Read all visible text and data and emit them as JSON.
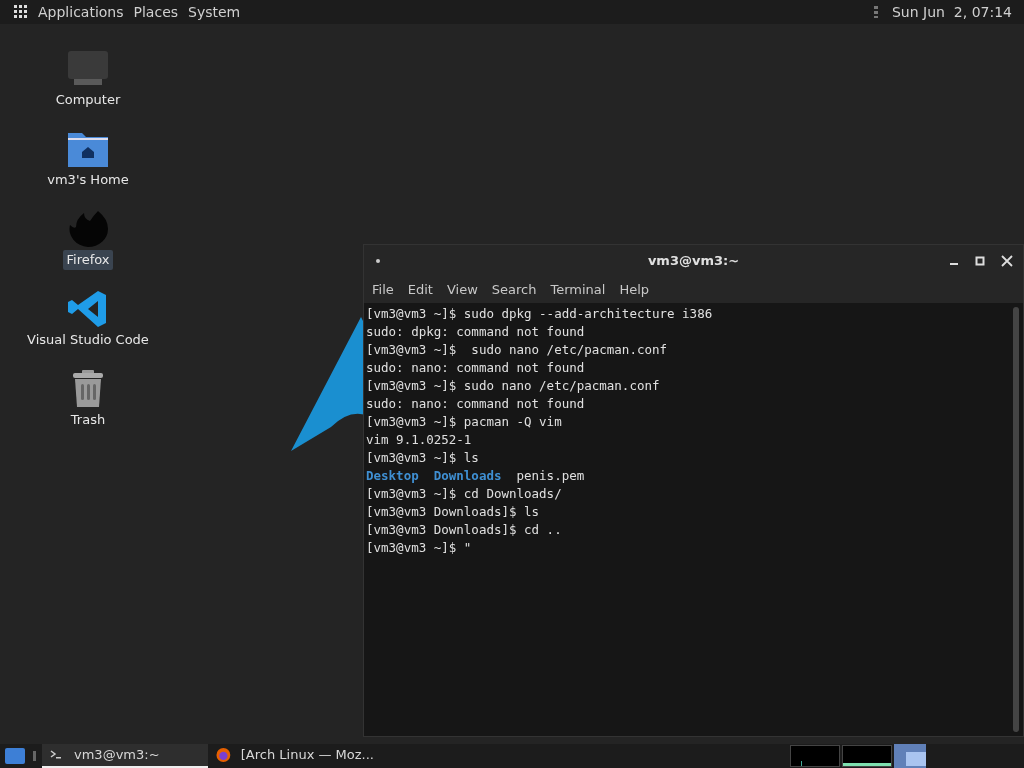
{
  "top_panel": {
    "menus": [
      "Applications",
      "Places",
      "System"
    ],
    "clock": "Sun Jun  2, 07:14"
  },
  "desktop_icons": [
    {
      "label": "Computer",
      "kind": "computer",
      "selected": false
    },
    {
      "label": "vm3's Home",
      "kind": "home",
      "selected": false
    },
    {
      "label": "Firefox",
      "kind": "firefox",
      "selected": true
    },
    {
      "label": "Visual Studio Code",
      "kind": "vscode",
      "selected": false
    },
    {
      "label": "Trash",
      "kind": "trash",
      "selected": false
    }
  ],
  "terminal": {
    "title": "vm3@vm3:~",
    "menu": [
      "File",
      "Edit",
      "View",
      "Search",
      "Terminal",
      "Help"
    ],
    "lines": [
      [
        {
          "kind": "text",
          "text": "[vm3@vm3 ~]$ sudo dpkg --add-architecture i386"
        }
      ],
      [
        {
          "kind": "text",
          "text": "sudo: dpkg: command not found"
        }
      ],
      [
        {
          "kind": "text",
          "text": "[vm3@vm3 ~]$  sudo nano /etc/pacman.conf"
        }
      ],
      [
        {
          "kind": "text",
          "text": "sudo: nano: command not found"
        }
      ],
      [
        {
          "kind": "text",
          "text": "[vm3@vm3 ~]$ sudo nano /etc/pacman.conf"
        }
      ],
      [
        {
          "kind": "text",
          "text": "sudo: nano: command not found"
        }
      ],
      [
        {
          "kind": "text",
          "text": "[vm3@vm3 ~]$ pacman -Q vim"
        }
      ],
      [
        {
          "kind": "text",
          "text": "vim 9.1.0252-1"
        }
      ],
      [
        {
          "kind": "text",
          "text": "[vm3@vm3 ~]$ ls"
        }
      ],
      [
        {
          "kind": "dir",
          "text": "Desktop"
        },
        {
          "kind": "dir",
          "text": "Downloads"
        },
        {
          "kind": "text",
          "text": "penis.pem"
        }
      ],
      [
        {
          "kind": "text",
          "text": "[vm3@vm3 ~]$ cd Downloads/"
        }
      ],
      [
        {
          "kind": "text",
          "text": "[vm3@vm3 Downloads]$ ls"
        }
      ],
      [
        {
          "kind": "text",
          "text": "[vm3@vm3 Downloads]$ cd .."
        }
      ],
      [
        {
          "kind": "text",
          "text": "[vm3@vm3 ~]$ \""
        }
      ]
    ]
  },
  "taskbar": {
    "tasks": [
      {
        "label": "vm3@vm3:~",
        "kind": "terminal",
        "selected": true
      },
      {
        "label": "[Arch Linux — Moz...",
        "kind": "firefox",
        "selected": false
      }
    ]
  }
}
